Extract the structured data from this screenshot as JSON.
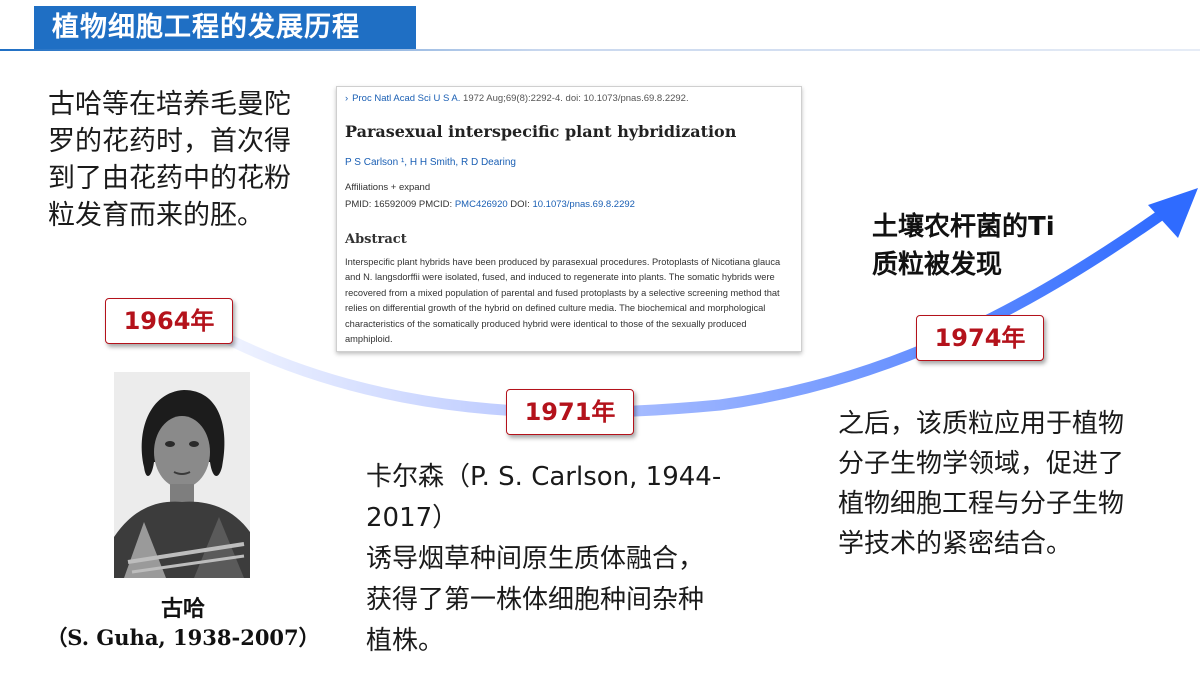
{
  "header": {
    "title": "植物细胞工程的发展历程"
  },
  "timeline": {
    "years": [
      "1964年",
      "1971年",
      "1974年"
    ],
    "colors": {
      "arrow_start": "#e8efff",
      "arrow_end": "#2f6bff",
      "year_border": "#b4121b",
      "title_bar": "#1f6fc4"
    }
  },
  "event_1964": {
    "text": "古哈等在培养毛曼陀罗的花药时，首次得到了由花药中的花粉粒发育而来的胚。"
  },
  "portrait": {
    "caption_name": "古哈",
    "caption_detail": "（S. Guha, 1938-2007）"
  },
  "paper": {
    "journal_name": "Proc Natl Acad Sci U S A.",
    "journal_meta": " 1972 Aug;69(8):2292-4. doi: 10.1073/pnas.69.8.2292.",
    "title": "Parasexual interspecific plant hybridization",
    "authors": "P S Carlson ¹, H H Smith, R D Dearing",
    "affiliations": "Affiliations  + expand",
    "pmid": "PMID: 16592009   PMCID: ",
    "pmcid": "PMC426920",
    "doi_label": "   DOI: ",
    "doi": "10.1073/pnas.69.8.2292",
    "abstract_heading": "Abstract",
    "abstract": "Interspecific plant hybrids have been produced by parasexual procedures. Protoplasts of Nicotiana glauca and N. langsdorffii were isolated, fused, and induced to regenerate into plants. The somatic hybrids were recovered from a mixed population of parental and fused protoplasts by a selective screening method that relies on differential growth of the hybrid on defined culture media. The biochemical and morphological characteristics of the somatically produced hybrid were identical to those of the sexually produced amphiploid."
  },
  "event_1971": {
    "line1": "卡尔森（P. S. Carlson, 1944-2017）",
    "line2": "诱导烟草种间原生质体融合，",
    "line3": "获得了第一株体细胞种间杂种",
    "line4": "植株。"
  },
  "event_1974": {
    "title_line1": "土壤农杆菌的Ti",
    "title_line2": "质粒被发现",
    "text": "之后，该质粒应用于植物分子生物学领域，促进了植物细胞工程与分子生物学技术的紧密结合。"
  }
}
